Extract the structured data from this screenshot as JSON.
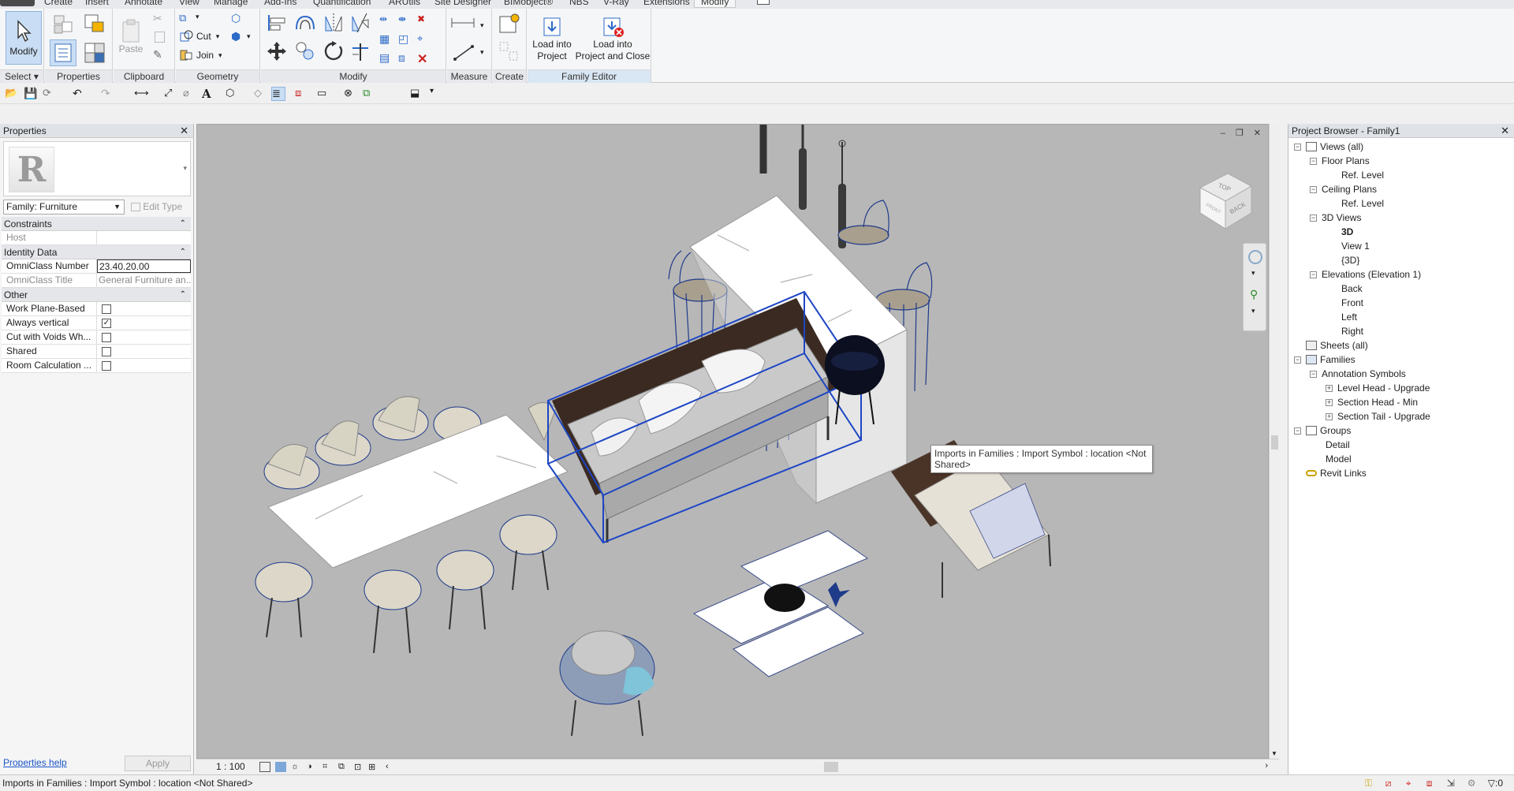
{
  "menu": {
    "tabs": [
      "Create",
      "Insert",
      "Annotate",
      "View",
      "Manage",
      "Add-Ins",
      "Quantification",
      "ARUtils",
      "Site Designer",
      "BIMobject®",
      "NBS",
      "V-Ray",
      "Extensions",
      "Modify"
    ],
    "active": "Modify"
  },
  "ribbon": {
    "modify_btn": "Modify",
    "select_label": "Select",
    "panels": {
      "properties": "Properties",
      "clipboard": "Clipboard",
      "geometry": "Geometry",
      "modify": "Modify",
      "measure": "Measure",
      "create": "Create",
      "family_editor": "Family Editor"
    },
    "paste": "Paste",
    "cut": "Cut",
    "join": "Join",
    "load_into_project_l1": "Load into",
    "load_into_project_l2": "Project",
    "load_close_l1": "Load into",
    "load_close_l2": "Project and Close"
  },
  "properties": {
    "title": "Properties",
    "close": "✕",
    "family": "Family: Furniture",
    "edit_type": "Edit Type",
    "groups": {
      "constraints": "Constraints",
      "identity": "Identity Data",
      "other": "Other"
    },
    "host_label": "Host",
    "host_value": "",
    "omniclass_number_label": "OmniClass Number",
    "omniclass_number_value": "23.40.20.00",
    "omniclass_title_label": "OmniClass Title",
    "omniclass_title_value": "General Furniture an...",
    "work_plane_label": "Work Plane-Based",
    "always_vertical_label": "Always vertical",
    "cut_voids_label": "Cut with Voids Wh...",
    "shared_label": "Shared",
    "room_calc_label": "Room Calculation ...",
    "help": "Properties help",
    "apply": "Apply"
  },
  "checkboxes": {
    "work_plane": false,
    "always_vertical": true,
    "cut_voids": false,
    "shared": false,
    "room_calc": false
  },
  "viewport": {
    "tooltip": "Imports in Families : Import Symbol : location <Not Shared>",
    "viewcube_top": "TOP",
    "viewcube_back": "BACK",
    "viewcube_front": "FRONT",
    "scale": "1 : 100",
    "window_controls": "‒ ❐ ✕"
  },
  "browser": {
    "title": "Project Browser - Family1",
    "close": "✕",
    "nodes": [
      {
        "label": "Views (all)"
      },
      {
        "label": "Floor Plans"
      },
      {
        "label": "Ref. Level"
      },
      {
        "label": "Ceiling Plans"
      },
      {
        "label": "Ref. Level"
      },
      {
        "label": "3D Views"
      },
      {
        "label": "3D"
      },
      {
        "label": "View 1"
      },
      {
        "label": "{3D}"
      },
      {
        "label": "Elevations (Elevation 1)"
      },
      {
        "label": "Back"
      },
      {
        "label": "Front"
      },
      {
        "label": "Left"
      },
      {
        "label": "Right"
      },
      {
        "label": "Sheets (all)"
      },
      {
        "label": "Families"
      },
      {
        "label": "Annotation Symbols"
      },
      {
        "label": "Level Head - Upgrade"
      },
      {
        "label": "Section Head - Min"
      },
      {
        "label": "Section Tail - Upgrade"
      },
      {
        "label": "Groups"
      },
      {
        "label": "Detail"
      },
      {
        "label": "Model"
      },
      {
        "label": "Revit Links"
      }
    ]
  },
  "status": {
    "message": "Imports in Families : Import Symbol : location <Not Shared>",
    "filter_count": ":0"
  },
  "colors": {
    "accent": "#1d46c4",
    "viewport_bg": "#b7b7b7",
    "link": "#1a55c9"
  }
}
